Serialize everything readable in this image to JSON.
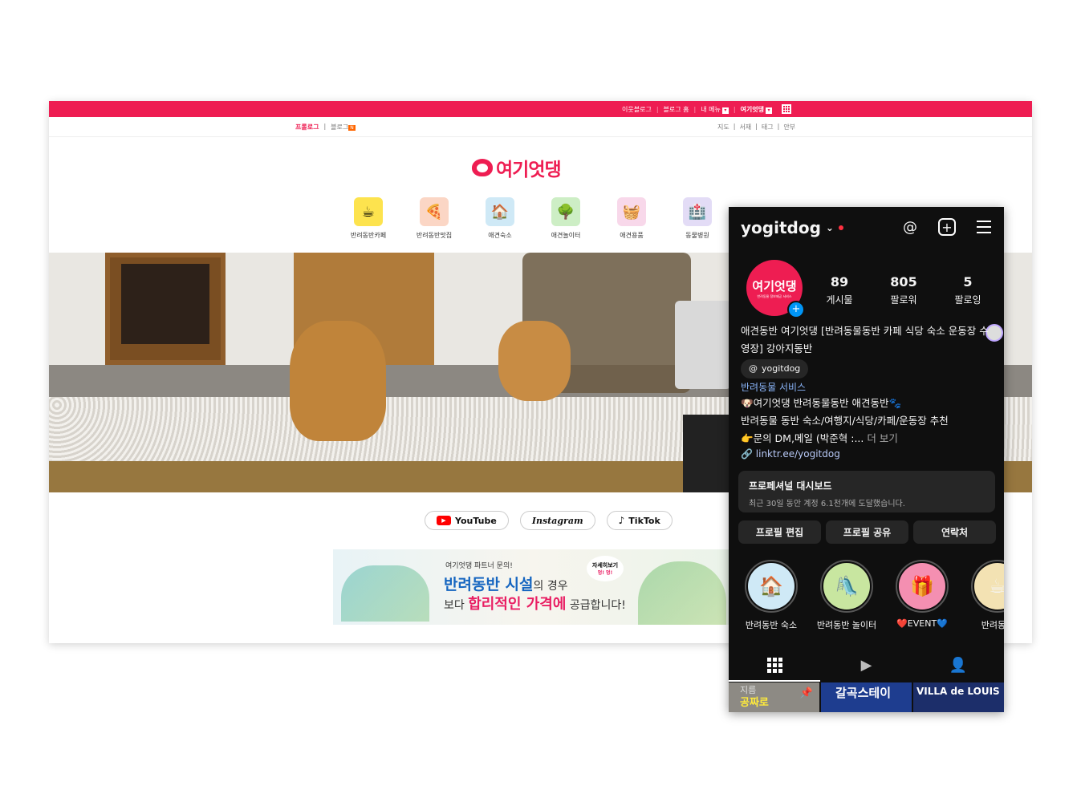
{
  "blog": {
    "topbar": {
      "neighbor": "이웃블로그",
      "home": "블로그 홈",
      "my_menu": "내 메뉴",
      "blog_name": "여기엇댕"
    },
    "subnav": {
      "prologue": "프롤로그",
      "blog": "블로그",
      "new_badge": "N",
      "map": "지도",
      "library": "서재",
      "tag": "태그",
      "about": "안부"
    },
    "logo_text": "여기엇댕",
    "categories": [
      {
        "label": "반려동반카페",
        "icon": "coffee-icon",
        "color": "#fde34e"
      },
      {
        "label": "반려동반맛집",
        "icon": "pizza-icon",
        "color": "#fbd6c5"
      },
      {
        "label": "애견숙소",
        "icon": "house-icon",
        "color": "#cfe9f6"
      },
      {
        "label": "애견놀이터",
        "icon": "fence-icon",
        "color": "#cdeec5"
      },
      {
        "label": "애견용품",
        "icon": "basket-icon",
        "color": "#f8d8ea"
      },
      {
        "label": "동물병원",
        "icon": "hospital-icon",
        "color": "#e3dcf6"
      }
    ],
    "social": {
      "youtube": "YouTube",
      "instagram": "Instagram",
      "tiktok": "TikTok"
    },
    "banner": {
      "sub": "여기엇댕 파트너 문의!",
      "line1_bold": "반려동반 시설",
      "line1_rest": "의 경우",
      "line2_pre": "보다 ",
      "line2_bold": "합리적인 가격에",
      "line2_rest": " 공급합니다!",
      "badge_top": "자세히보기",
      "badge_bottom": "멍! 멍!"
    }
  },
  "instagram": {
    "username": "yogitdog",
    "avatar_text": "여기엇댕",
    "avatar_sub": "반려동물 정보제공 서비스",
    "stats": [
      {
        "value": "89",
        "label": "게시물"
      },
      {
        "value": "805",
        "label": "팔로워"
      },
      {
        "value": "5",
        "label": "팔로잉"
      }
    ],
    "bio_name": "애견동반 여기엇댕 [반려동물동반 카페 식당 숙소 운동장 수영장] 강아지동반",
    "threads_handle": "yogitdog",
    "category": "반려동물 서비스",
    "bio_line1": "🐶여기엇댕 반려동물동반 애견동반🐾",
    "bio_line2": "반려동물 동반 숙소/여행지/식당/카페/운동장 추천",
    "bio_line3": "👉문의 DM,메일 (박준혁 :...",
    "more": "더 보기",
    "link": "linktr.ee/yogitdog",
    "dashboard": {
      "title": "프로페셔널 대시보드",
      "sub": "최근 30일 동안 계정 6.1천개에 도달했습니다."
    },
    "buttons": {
      "edit": "프로필 편집",
      "share": "프로필 공유",
      "contact": "연락처"
    },
    "highlights": [
      {
        "label": "반려동반 숙소",
        "icon": "house-icon",
        "color": "#cfe9f6"
      },
      {
        "label": "반려동반 놀이터",
        "icon": "playground-icon",
        "color": "#c8e6a0"
      },
      {
        "label": "❤️EVENT💙",
        "icon": "gift-icon",
        "color": "#f48fb1"
      },
      {
        "label": "반려동반",
        "icon": "coffee-icon",
        "color": "#f3e2b3"
      }
    ],
    "posts": {
      "p1_t1": "지름",
      "p1_t2": "공짜로",
      "p2": "갈곡스테이",
      "p3": "VILLA de LOUIS"
    }
  }
}
